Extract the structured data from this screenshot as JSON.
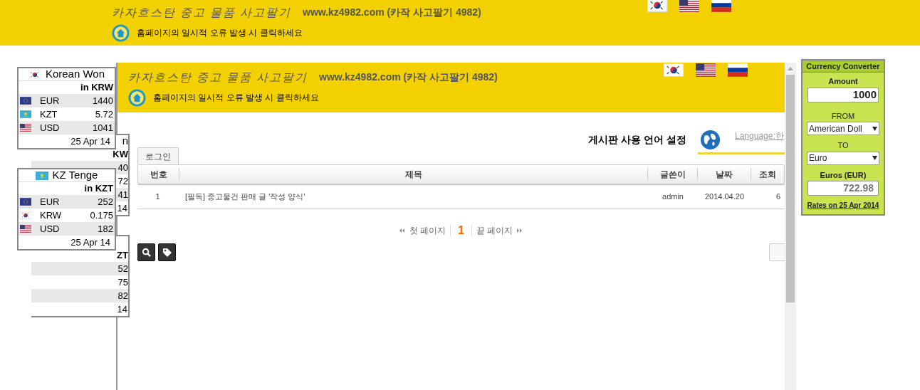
{
  "banner": {
    "title": "카자흐스탄 중고 물품 사고팔기",
    "site": "www.kz4982.com (카작 사고팔기 4982)",
    "notice": "홈페이지의 일시적 오류 발생 시 클릭하세요"
  },
  "rate_widgets": [
    {
      "kind": "kr",
      "title": "Korean Won",
      "unit": "in KRW",
      "rows": [
        {
          "kind": "eu",
          "code": "EUR",
          "value": "1440"
        },
        {
          "kind": "kz",
          "code": "KZT",
          "value": "5.72"
        },
        {
          "kind": "us",
          "code": "USD",
          "value": "1041"
        }
      ],
      "date": "25 Apr 14"
    },
    {
      "kind": "kz",
      "title": "KZ Tenge",
      "unit": "in KZT",
      "rows": [
        {
          "kind": "eu",
          "code": "EUR",
          "value": "252"
        },
        {
          "kind": "kr",
          "code": "KRW",
          "value": "0.175"
        },
        {
          "kind": "us",
          "code": "USD",
          "value": "182"
        }
      ],
      "date": "25 Apr 14"
    }
  ],
  "hidden_widgets": [
    {
      "title": "n",
      "unit": "KW",
      "values": [
        "40",
        "72",
        "41"
      ],
      "date": "14"
    },
    {
      "unit": "ZT",
      "values": [
        "52",
        "75",
        "82"
      ],
      "date": "14"
    }
  ],
  "frame": {
    "banner": {
      "title": "카자흐스탄 중고 물품 사고팔기",
      "site": "www.kz4982.com (카작 사고팔기 4982)",
      "notice": "홈페이지의 일시적 오류 발생 시 클릭하세요"
    },
    "board": {
      "lang_title": "게시판 사용 언어 설정",
      "lang_link": "Language:한",
      "tabs": [
        {
          "label": "로그인",
          "selected": true
        }
      ],
      "columns": [
        "번호",
        "제목",
        "글쓴이",
        "날짜",
        "조회"
      ],
      "rows": [
        {
          "cells": [
            "1",
            "[필독] 중고물건 판매 글 '작성 양식'",
            "admin",
            "2014.04.20",
            "6"
          ]
        }
      ],
      "pagination": {
        "first": "첫 페이지",
        "pages": [
          {
            "label": "1",
            "selected": true
          }
        ],
        "last": "끝 페이지"
      }
    }
  },
  "converter": {
    "title": "Currency Converter",
    "amount_label": "Amount",
    "amount": "1000",
    "from_label": "FROM",
    "from": "American Doll",
    "to_label": "TO",
    "to": "Euro",
    "result_label": "Euros (EUR)",
    "result": "722.98",
    "rates": "Rates on 25 Apr 2014"
  }
}
